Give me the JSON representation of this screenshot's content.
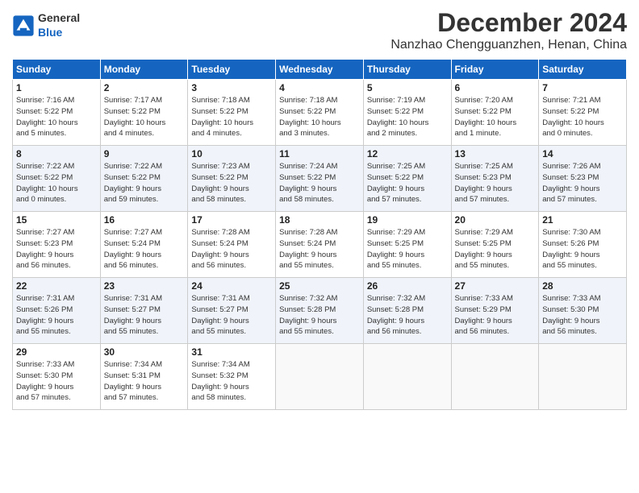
{
  "header": {
    "logo_general": "General",
    "logo_blue": "Blue",
    "month": "December 2024",
    "location": "Nanzhao Chengguanzhen, Henan, China"
  },
  "days_of_week": [
    "Sunday",
    "Monday",
    "Tuesday",
    "Wednesday",
    "Thursday",
    "Friday",
    "Saturday"
  ],
  "weeks": [
    [
      {
        "day": "1",
        "info": "Sunrise: 7:16 AM\nSunset: 5:22 PM\nDaylight: 10 hours\nand 5 minutes."
      },
      {
        "day": "2",
        "info": "Sunrise: 7:17 AM\nSunset: 5:22 PM\nDaylight: 10 hours\nand 4 minutes."
      },
      {
        "day": "3",
        "info": "Sunrise: 7:18 AM\nSunset: 5:22 PM\nDaylight: 10 hours\nand 4 minutes."
      },
      {
        "day": "4",
        "info": "Sunrise: 7:18 AM\nSunset: 5:22 PM\nDaylight: 10 hours\nand 3 minutes."
      },
      {
        "day": "5",
        "info": "Sunrise: 7:19 AM\nSunset: 5:22 PM\nDaylight: 10 hours\nand 2 minutes."
      },
      {
        "day": "6",
        "info": "Sunrise: 7:20 AM\nSunset: 5:22 PM\nDaylight: 10 hours\nand 1 minute."
      },
      {
        "day": "7",
        "info": "Sunrise: 7:21 AM\nSunset: 5:22 PM\nDaylight: 10 hours\nand 0 minutes."
      }
    ],
    [
      {
        "day": "8",
        "info": "Sunrise: 7:22 AM\nSunset: 5:22 PM\nDaylight: 10 hours\nand 0 minutes."
      },
      {
        "day": "9",
        "info": "Sunrise: 7:22 AM\nSunset: 5:22 PM\nDaylight: 9 hours\nand 59 minutes."
      },
      {
        "day": "10",
        "info": "Sunrise: 7:23 AM\nSunset: 5:22 PM\nDaylight: 9 hours\nand 58 minutes."
      },
      {
        "day": "11",
        "info": "Sunrise: 7:24 AM\nSunset: 5:22 PM\nDaylight: 9 hours\nand 58 minutes."
      },
      {
        "day": "12",
        "info": "Sunrise: 7:25 AM\nSunset: 5:22 PM\nDaylight: 9 hours\nand 57 minutes."
      },
      {
        "day": "13",
        "info": "Sunrise: 7:25 AM\nSunset: 5:23 PM\nDaylight: 9 hours\nand 57 minutes."
      },
      {
        "day": "14",
        "info": "Sunrise: 7:26 AM\nSunset: 5:23 PM\nDaylight: 9 hours\nand 57 minutes."
      }
    ],
    [
      {
        "day": "15",
        "info": "Sunrise: 7:27 AM\nSunset: 5:23 PM\nDaylight: 9 hours\nand 56 minutes."
      },
      {
        "day": "16",
        "info": "Sunrise: 7:27 AM\nSunset: 5:24 PM\nDaylight: 9 hours\nand 56 minutes."
      },
      {
        "day": "17",
        "info": "Sunrise: 7:28 AM\nSunset: 5:24 PM\nDaylight: 9 hours\nand 56 minutes."
      },
      {
        "day": "18",
        "info": "Sunrise: 7:28 AM\nSunset: 5:24 PM\nDaylight: 9 hours\nand 55 minutes."
      },
      {
        "day": "19",
        "info": "Sunrise: 7:29 AM\nSunset: 5:25 PM\nDaylight: 9 hours\nand 55 minutes."
      },
      {
        "day": "20",
        "info": "Sunrise: 7:29 AM\nSunset: 5:25 PM\nDaylight: 9 hours\nand 55 minutes."
      },
      {
        "day": "21",
        "info": "Sunrise: 7:30 AM\nSunset: 5:26 PM\nDaylight: 9 hours\nand 55 minutes."
      }
    ],
    [
      {
        "day": "22",
        "info": "Sunrise: 7:31 AM\nSunset: 5:26 PM\nDaylight: 9 hours\nand 55 minutes."
      },
      {
        "day": "23",
        "info": "Sunrise: 7:31 AM\nSunset: 5:27 PM\nDaylight: 9 hours\nand 55 minutes."
      },
      {
        "day": "24",
        "info": "Sunrise: 7:31 AM\nSunset: 5:27 PM\nDaylight: 9 hours\nand 55 minutes."
      },
      {
        "day": "25",
        "info": "Sunrise: 7:32 AM\nSunset: 5:28 PM\nDaylight: 9 hours\nand 55 minutes."
      },
      {
        "day": "26",
        "info": "Sunrise: 7:32 AM\nSunset: 5:28 PM\nDaylight: 9 hours\nand 56 minutes."
      },
      {
        "day": "27",
        "info": "Sunrise: 7:33 AM\nSunset: 5:29 PM\nDaylight: 9 hours\nand 56 minutes."
      },
      {
        "day": "28",
        "info": "Sunrise: 7:33 AM\nSunset: 5:30 PM\nDaylight: 9 hours\nand 56 minutes."
      }
    ],
    [
      {
        "day": "29",
        "info": "Sunrise: 7:33 AM\nSunset: 5:30 PM\nDaylight: 9 hours\nand 57 minutes."
      },
      {
        "day": "30",
        "info": "Sunrise: 7:34 AM\nSunset: 5:31 PM\nDaylight: 9 hours\nand 57 minutes."
      },
      {
        "day": "31",
        "info": "Sunrise: 7:34 AM\nSunset: 5:32 PM\nDaylight: 9 hours\nand 58 minutes."
      },
      {
        "day": "",
        "info": ""
      },
      {
        "day": "",
        "info": ""
      },
      {
        "day": "",
        "info": ""
      },
      {
        "day": "",
        "info": ""
      }
    ]
  ]
}
